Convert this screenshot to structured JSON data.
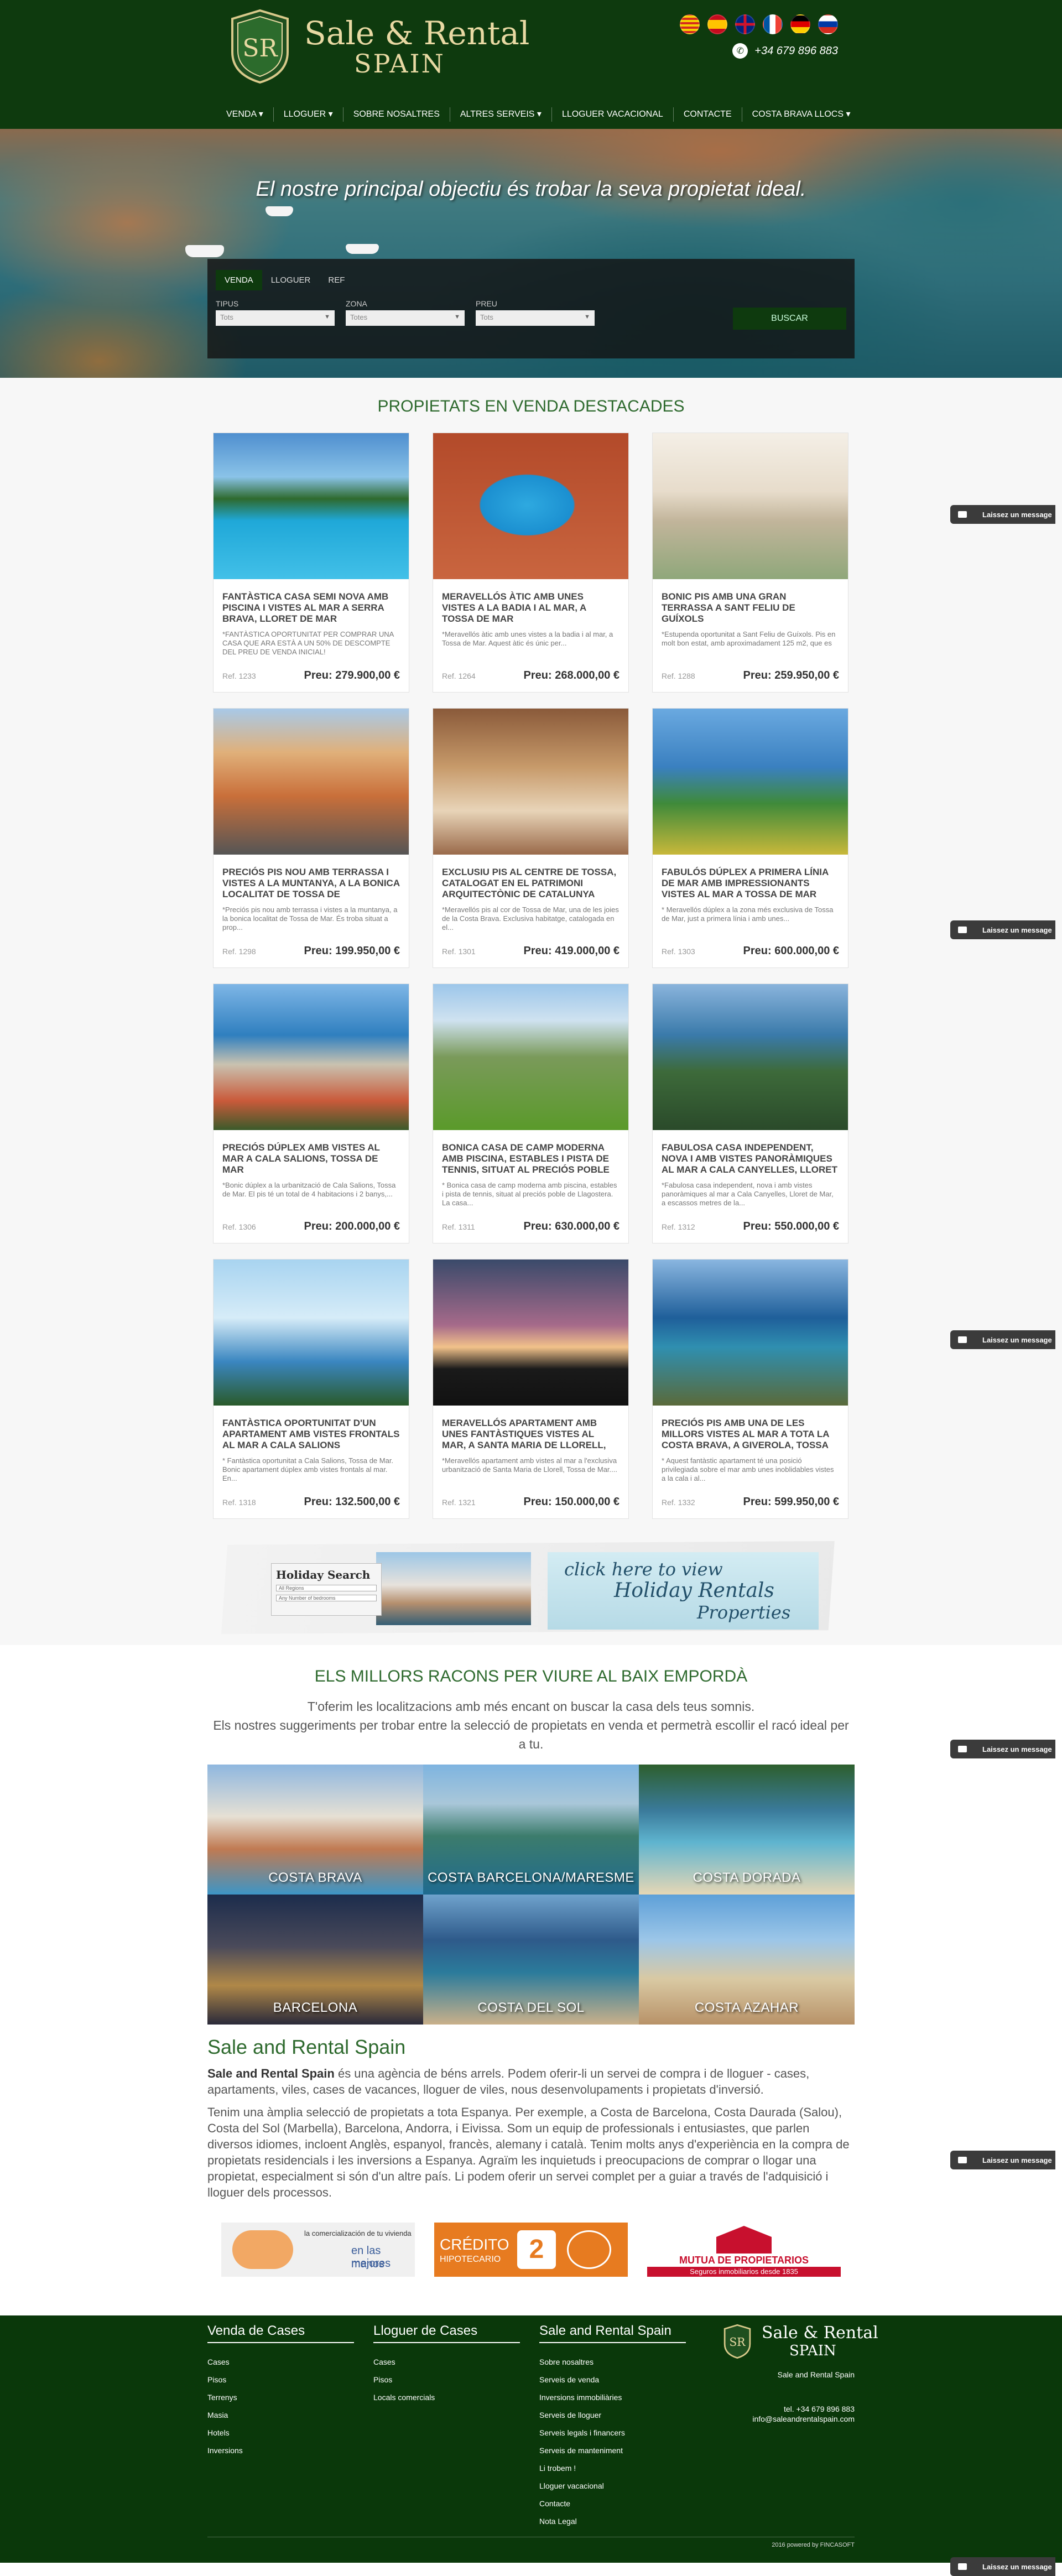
{
  "site": {
    "logo_name": "Sale & Rental",
    "logo_sub": "SPAIN",
    "phone": "+34 679 896 883",
    "flags": [
      "catalan-flag",
      "spanish-flag",
      "uk-flag",
      "french-flag",
      "german-flag",
      "russian-flag"
    ]
  },
  "nav": [
    {
      "label": "VENDA",
      "caret": "▾"
    },
    {
      "label": "LLOGUER",
      "caret": "▾"
    },
    {
      "label": "SOBRE NOSALTRES",
      "caret": ""
    },
    {
      "label": "ALTRES SERVEIS",
      "caret": "▾"
    },
    {
      "label": "LLOGUER VACACIONAL",
      "caret": ""
    },
    {
      "label": "CONTACTE",
      "caret": ""
    },
    {
      "label": "COSTA BRAVA LLOCS",
      "caret": "▾"
    }
  ],
  "hero": {
    "tagline": "El nostre principal objectiu és trobar la seva propietat ideal.",
    "tabs": [
      "VENDA",
      "LLOGUER",
      "REF"
    ],
    "fields": [
      {
        "label": "TIPUS",
        "value": "Tots"
      },
      {
        "label": "ZONA",
        "value": "Totes"
      },
      {
        "label": "PREU",
        "value": "Tots"
      }
    ],
    "search_button": "BUSCAR"
  },
  "properties": {
    "title": "PROPIETATS EN VENDA DESTACADES",
    "price_label": "Preu:",
    "items": [
      {
        "title": "FANTÀSTICA CASA SEMI NOVA AMB PISCINA I VISTES AL MAR A SERRA BRAVA, LLORET DE MAR",
        "desc": "*FANTÀSTICA OPORTUNITAT PER COMPRAR UNA CASA QUE ARA ESTÀ A UN 50% DE DESCOMPTE DEL PREU DE VENDA INICIAL!",
        "ref": "Ref. 1233",
        "price": "279.900,00 €"
      },
      {
        "title": "MERAVELLÓS ÀTIC AMB UNES VISTES A LA BADIA I AL MAR, A TOSSA DE MAR",
        "desc": "*Meravellós àtic amb unes vistes a la badia i al mar, a Tossa de Mar. Aquest àtic és únic per...",
        "ref": "Ref. 1264",
        "price": "268.000,00 €"
      },
      {
        "title": "BONIC PIS AMB UNA GRAN TERRASSA A SANT FELIU DE GUÍXOLS",
        "desc": "*Estupenda oportunitat a Sant Feliu de Guíxols. Pis en molt bon estat, amb aproximadament 125 m2, que es",
        "ref": "Ref. 1288",
        "price": "259.950,00 €"
      },
      {
        "title": "PRECIÓS PIS NOU AMB TERRASSA I VISTES A LA MUNTANYA, A LA BONICA LOCALITAT DE TOSSA DE",
        "desc": "*Preciós pis nou amb terrassa i vistes a la muntanya, a la bonica localitat de Tossa de Mar. És troba situat a prop...",
        "ref": "Ref. 1298",
        "price": "199.950,00 €"
      },
      {
        "title": "EXCLUSIU PIS AL CENTRE DE TOSSA, CATALOGAT EN EL PATRIMONI ARQUITECTÒNIC DE CATALUNYA",
        "desc": "*Meravellós pis al cor de Tossa de Mar, una de les joies de la Costa Brava. Exclusiva habitatge, catalogada en el...",
        "ref": "Ref. 1301",
        "price": "419.000,00 €"
      },
      {
        "title": "FABULÓS DÚPLEX A PRIMERA LÍNIA DE MAR AMB IMPRESSIONANTS VISTES AL MAR A TOSSA DE MAR",
        "desc": "* Meravellós dúplex a la zona més exclusiva de Tossa de Mar, just a primera línia i amb unes...",
        "ref": "Ref. 1303",
        "price": "600.000,00 €"
      },
      {
        "title": "PRECIÓS DÚPLEX AMB VISTES AL MAR A CALA SALIONS, TOSSA DE MAR",
        "desc": "*Bonic dúplex a la urbanització de Cala Salions, Tossa de Mar. El pis té un total de 4 habitacions i 2 banys,...",
        "ref": "Ref. 1306",
        "price": "200.000,00 €"
      },
      {
        "title": "BONICA CASA DE CAMP MODERNA AMB PISCINA, ESTABLES I PISTA DE TENNIS, SITUAT AL PRECIÓS POBLE",
        "desc": "* Bonica casa de camp moderna amb piscina, estables i pista de tennis, situat al preciós poble de Llagostera. La casa...",
        "ref": "Ref. 1311",
        "price": "630.000,00 €"
      },
      {
        "title": "FABULOSA CASA INDEPENDENT, NOVA I AMB VISTES PANORÀMIQUES AL MAR A CALA CANYELLES, LLORET",
        "desc": "*Fabulosa casa independent, nova i amb vistes panoràmiques al mar a Cala Canyelles, Lloret de Mar, a escassos metres de la...",
        "ref": "Ref. 1312",
        "price": "550.000,00 €"
      },
      {
        "title": "FANTÀSTICA OPORTUNITAT D'UN APARTAMENT AMB VISTES FRONTALS AL MAR A CALA SALIONS",
        "desc": "* Fantàstica oportunitat a Cala Salions, Tossa de Mar. Bonic apartament dúplex amb vistes frontals al mar. En...",
        "ref": "Ref. 1318",
        "price": "132.500,00 €"
      },
      {
        "title": "MERAVELLÓS APARTAMENT AMB UNES FANTÀSTIQUES VISTES AL MAR, A SANTA MARIA DE LLORELL, TOSSA",
        "desc": "*Meravellós apartament amb vistes al mar a l'exclusiva urbanització de Santa Maria de Llorell, Tossa de Mar....",
        "ref": "Ref. 1321",
        "price": "150.000,00 €"
      },
      {
        "title": "PRECIÓS PIS AMB UNA DE LES MILLORS VISTES AL MAR A TOTA LA COSTA BRAVA, A GIVEROLA, TOSSA",
        "desc": "* Aquest fantàstic apartament té una posició privilegiada sobre el mar amb unes inoblidables vistes a la cala i al...",
        "ref": "Ref. 1332",
        "price": "599.950,00 €"
      }
    ]
  },
  "banner": {
    "search_title": "Holiday Search",
    "field1": "All Regions",
    "field2": "Any Number of bedrooms",
    "line1": "click here to view",
    "line2": "Holiday Rentals",
    "line3": "Properties"
  },
  "places": {
    "title": "ELS MILLORS RACONS PER VIURE AL BAIX EMPORDÀ",
    "intro1": "T'oferim les localitzacions amb més encant on buscar la casa dels teus somnis.",
    "intro2": "Els nostres suggeriments per trobar entre la selecció de propietats en venda et permetrà escollir el racó ideal per a tu.",
    "tiles": [
      "COSTA BRAVA",
      "COSTA BARCELONA/MARESME",
      "COSTA DORADA",
      "BARCELONA",
      "COSTA DEL SOL",
      "COSTA AZAHAR"
    ]
  },
  "about": {
    "title": "Sale and Rental Spain",
    "p1_bold": "Sale and Rental Spain",
    "p1_rest": " és una agència de béns arrels. Podem oferir-li un servei de compra i de lloguer - cases, apartaments, viles, cases de vacances, lloguer de viles, nous desenvolupaments i propietats d'inversió.",
    "p2": "Tenim una àmplia selecció de propietats a tota Espanya. Per exemple, a Costa de Barcelona, Costa Daurada (Salou), Costa del Sol (Marbella), Barcelona, Andorra, i Eivissa. Som un equip de professionals i entusiastes, que parlen diversos idiomes, incloent Anglès, espanyol, francès, alemany i català. Tenim molts anys d'experiència en la compra de propietats residencials i les inversions a Espanya. Agraïm les inquietuds i preocupacions de comprar o llogar una propietat, especialment si són d'un altre país. Li podem oferir un servei complet per a guiar a través de l'adquisició i lloguer dels processos."
  },
  "partners": {
    "p1_top": "la comercialización de tu vivienda",
    "p1_a": "en las mejores",
    "p1_b": "manos",
    "p2_a": "CRÉDITO",
    "p2_b": "HIPOTECARIO",
    "p2_num": "2",
    "p3_a": "MUTUA DE PROPIETARIOS",
    "p3_b": "Seguros inmobiliarios desde 1835"
  },
  "footer": {
    "col1": {
      "title": "Venda de Cases",
      "links": [
        "Cases",
        "Pisos",
        "Terrenys",
        "Masia",
        "Hotels",
        "Inversions"
      ]
    },
    "col2": {
      "title": "Lloguer de Cases",
      "links": [
        "Cases",
        "Pisos",
        "Locals comercials"
      ]
    },
    "col3": {
      "title": "Sale and Rental Spain",
      "links": [
        "Sobre nosaltres",
        "Serveis de venda",
        "Inversions immobiliàries",
        "Serveis de lloguer",
        "Serveis legals i financers",
        "Serveis de manteniment",
        "Li trobem !",
        "Lloguer vacacional",
        "Contacte",
        "Nota Legal"
      ]
    },
    "company": "Sale and Rental Spain",
    "tel": "tel. +34 679 896 883",
    "email": "info@saleandrentalspain.com",
    "copyright": "2016 powered by FINCASOFT"
  },
  "chat": {
    "label": "Laissez un message"
  }
}
